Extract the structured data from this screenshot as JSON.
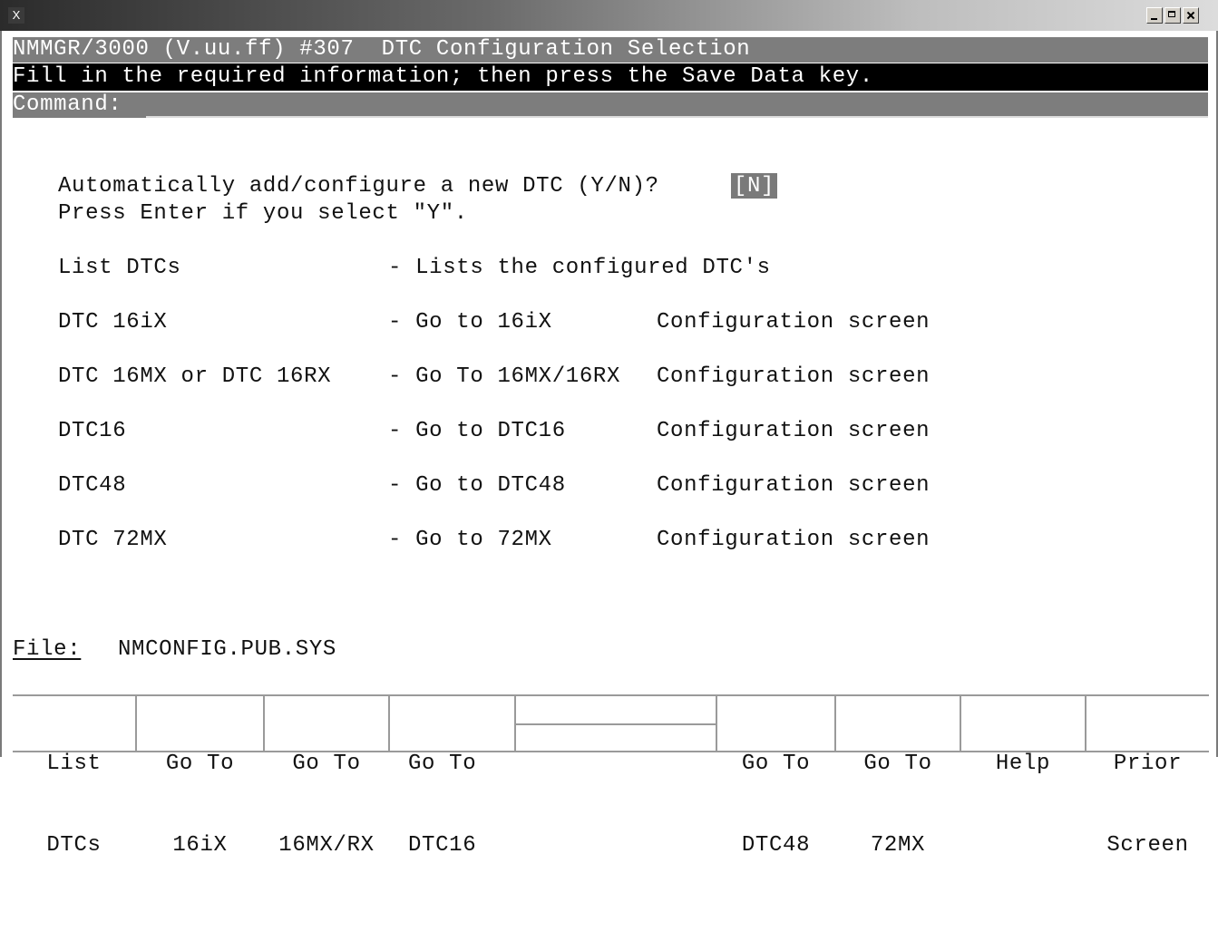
{
  "window": {
    "title_icon": "X"
  },
  "screen": {
    "header": "NMMGR/3000 (V.uu.ff) #307  DTC Configuration Selection",
    "instruction": "Fill in the required information; then press the Save Data key.",
    "command_label": "Command:",
    "command_value": ""
  },
  "auto_config": {
    "prompt": "Automatically add/configure a new DTC (Y/N)?",
    "value": "[N]",
    "note": "Press Enter if you select \"Y\"."
  },
  "options": [
    {
      "name": "List DTCs",
      "desc": "- Lists the configured DTC's",
      "tail": ""
    },
    {
      "name": "DTC 16iX",
      "desc": "- Go to 16iX",
      "tail": "Configuration screen"
    },
    {
      "name": "DTC 16MX or DTC 16RX",
      "desc": "- Go To 16MX/16RX",
      "tail": "Configuration screen"
    },
    {
      "name": "DTC16",
      "desc": "- Go to DTC16",
      "tail": "Configuration screen"
    },
    {
      "name": "DTC48",
      "desc": "- Go to DTC48",
      "tail": "Configuration screen"
    },
    {
      "name": "DTC 72MX",
      "desc": "- Go to 72MX",
      "tail": "Configuration screen"
    }
  ],
  "file": {
    "label": "File:",
    "value": "NMCONFIG.PUB.SYS"
  },
  "function_keys": [
    {
      "line1": "List",
      "line2": "DTCs"
    },
    {
      "line1": "Go To",
      "line2": "16iX"
    },
    {
      "line1": "Go To",
      "line2": "16MX/RX"
    },
    {
      "line1": "Go To",
      "line2": "DTC16"
    },
    {
      "line1": "",
      "line2": ""
    },
    {
      "line1": "Go To",
      "line2": "DTC48"
    },
    {
      "line1": "Go To",
      "line2": "72MX"
    },
    {
      "line1": "Help",
      "line2": ""
    },
    {
      "line1": "Prior",
      "line2": "Screen"
    }
  ]
}
